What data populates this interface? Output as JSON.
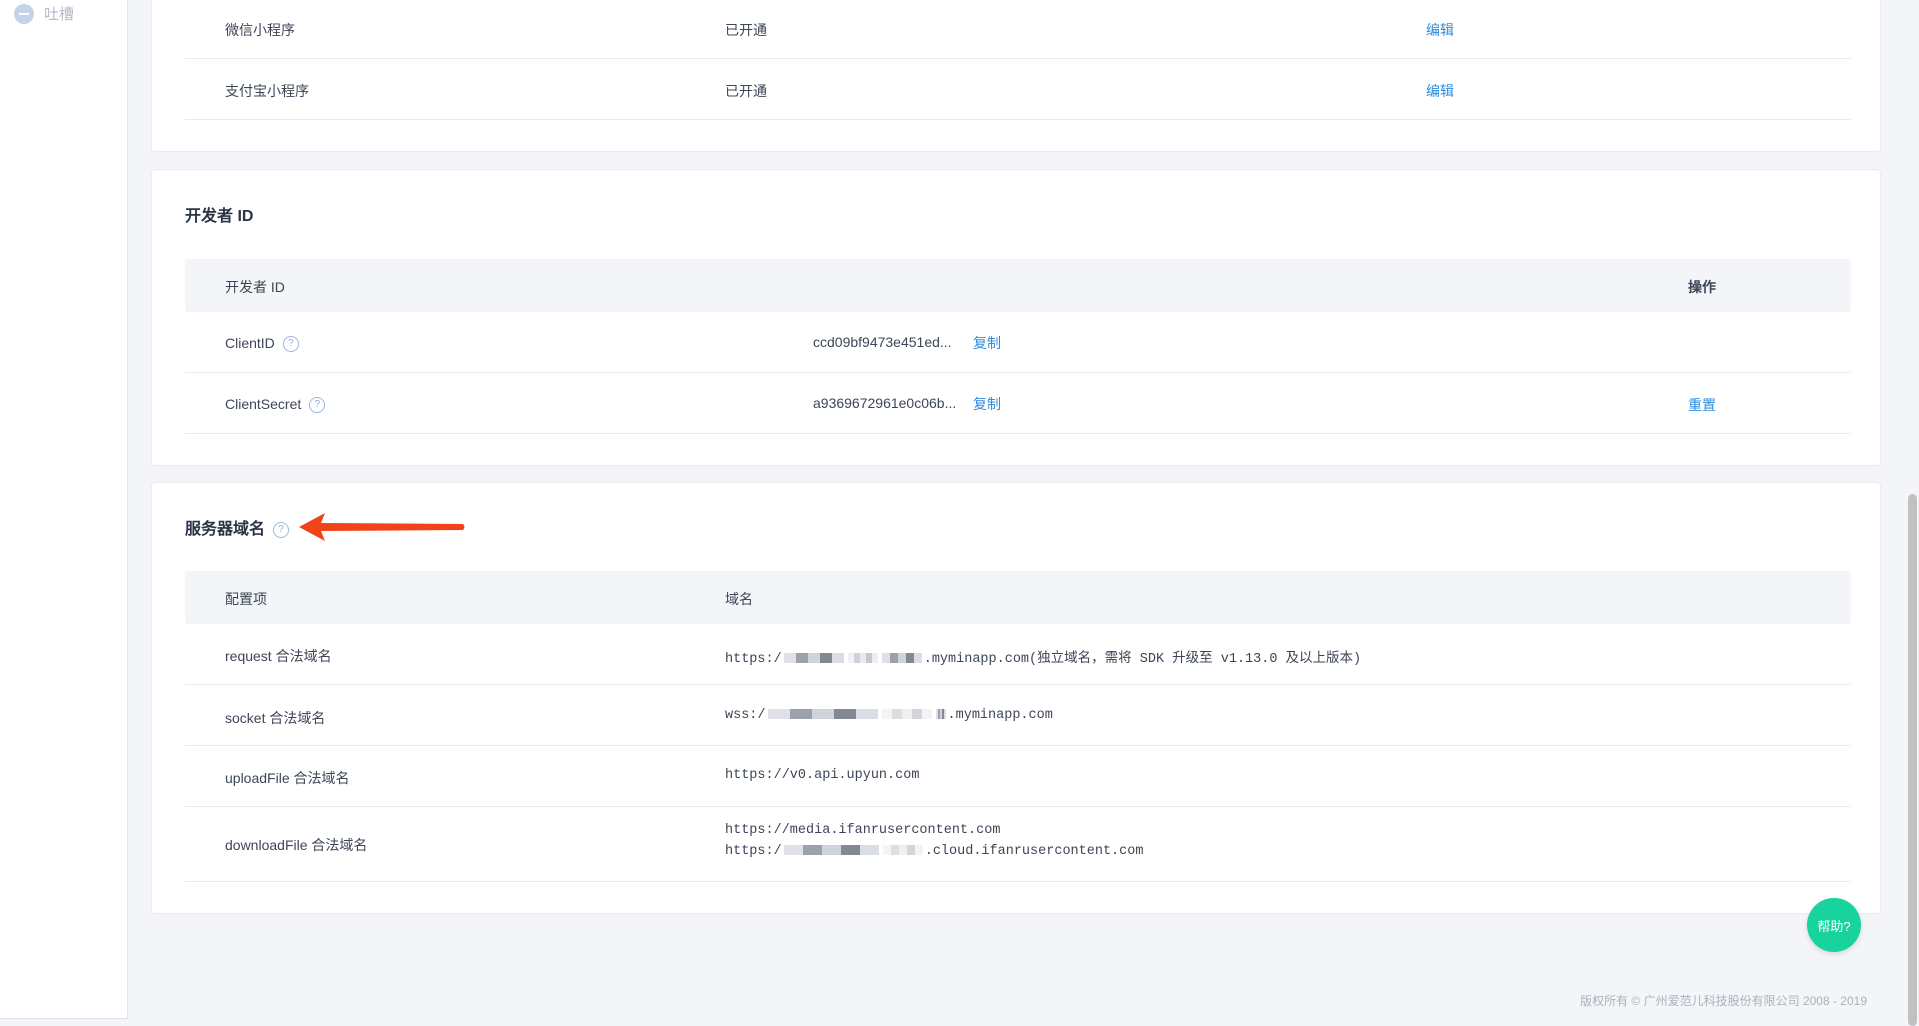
{
  "sidebar": {
    "feedback_label": "吐槽"
  },
  "mini_programs": {
    "rows": [
      {
        "name": "微信小程序",
        "status": "已开通",
        "action": "编辑"
      },
      {
        "name": "支付宝小程序",
        "status": "已开通",
        "action": "编辑"
      }
    ]
  },
  "developer_id": {
    "title": "开发者 ID",
    "header": {
      "col1": "开发者 ID",
      "col3": "操作"
    },
    "rows": [
      {
        "name": "ClientID",
        "value": "ccd09bf9473e451ed...",
        "copy": "复制",
        "action": ""
      },
      {
        "name": "ClientSecret",
        "value": "a9369672961e0c06b...",
        "copy": "复制",
        "action": "重置"
      }
    ]
  },
  "server_domain": {
    "title": "服务器域名",
    "header": {
      "col1": "配置项",
      "col2": "域名"
    },
    "rows": [
      {
        "name": "request 合法域名",
        "prefix": "https:/",
        "suffix": ".myminapp.com(独立域名，需将 SDK 升级至 v1.13.0 及以上版本)"
      },
      {
        "name": "socket 合法域名",
        "prefix": "wss:/",
        "suffix": ".myminapp.com"
      },
      {
        "name": "uploadFile 合法域名",
        "value": "https://v0.api.upyun.com"
      },
      {
        "name": "downloadFile 合法域名",
        "line1": "https://media.ifanrusercontent.com",
        "line2_prefix": "https:/",
        "line2_suffix": ".cloud.ifanrusercontent.com"
      }
    ]
  },
  "help_button": "帮助?",
  "footer": "版权所有 © 广州爱范儿科技股份有限公司 2008 - 2019",
  "colors": {
    "accent": "#2d8ce0",
    "help": "#18d39e",
    "arrow": "#f0431a"
  },
  "icons": {
    "help": "question-circle-icon",
    "sidebar": "chat-bubble-icon"
  }
}
